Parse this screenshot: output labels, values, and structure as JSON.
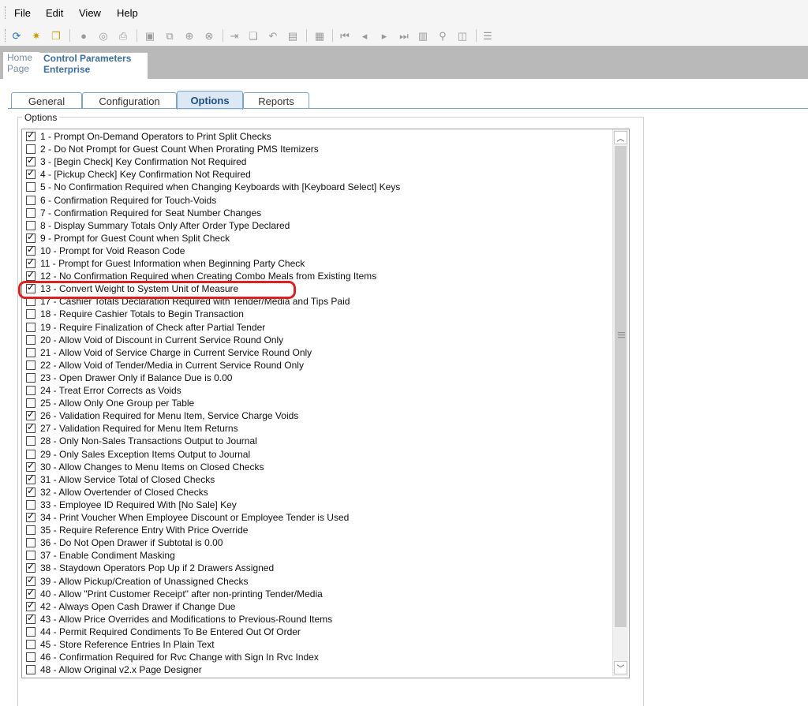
{
  "menubar": {
    "file": "File",
    "edit": "Edit",
    "view": "View",
    "help": "Help"
  },
  "toolbar_icons": [
    "refresh-icon",
    "new-icon",
    "new-copy-icon",
    "record-icon",
    "zoom-icon",
    "print-icon",
    "save-icon",
    "save-all-icon",
    "add-icon",
    "delete-icon",
    "insert-icon",
    "copy-icon",
    "undo-icon",
    "paste-icon",
    "table-icon",
    "first-icon",
    "prev-icon",
    "next-icon",
    "last-icon",
    "goto-icon",
    "find-icon",
    "view-icon",
    "grid-icon"
  ],
  "page_tabs": {
    "home": {
      "line1": "Home",
      "line2": "Page"
    },
    "control": {
      "line1": "Control Parameters",
      "line2": "Enterprise"
    }
  },
  "inner_tabs": [
    {
      "label": "General",
      "active": false
    },
    {
      "label": "Configuration",
      "active": false
    },
    {
      "label": "Options",
      "active": true
    },
    {
      "label": "Reports",
      "active": false
    }
  ],
  "options_group": {
    "legend": "Options",
    "items": [
      {
        "label": "1 - Prompt On-Demand Operators to Print Split Checks",
        "checked": true
      },
      {
        "label": "2 - Do Not Prompt for Guest Count When Prorating PMS Itemizers",
        "checked": false
      },
      {
        "label": "3 - [Begin Check] Key Confirmation Not Required",
        "checked": true
      },
      {
        "label": "4 - [Pickup Check] Key Confirmation Not Required",
        "checked": true
      },
      {
        "label": "5 - No Confirmation Required when Changing Keyboards with [Keyboard Select] Keys",
        "checked": false
      },
      {
        "label": "6 - Confirmation Required for Touch-Voids",
        "checked": false
      },
      {
        "label": "7 - Confirmation Required for Seat Number Changes",
        "checked": false
      },
      {
        "label": "8 - Display Summary Totals Only After Order Type Declared",
        "checked": false
      },
      {
        "label": "9 - Prompt for Guest Count when Split Check",
        "checked": true
      },
      {
        "label": "10 - Prompt for Void Reason Code",
        "checked": true
      },
      {
        "label": "11 - Prompt for Guest Information when Beginning Party Check",
        "checked": true
      },
      {
        "label": "12 - No Confirmation Required when Creating Combo Meals from Existing Items",
        "checked": true
      },
      {
        "label": "13 - Convert Weight to System Unit of Measure",
        "checked": true
      },
      {
        "label": "17 - Cashier Totals Declaration Required with Tender/Media and Tips Paid",
        "checked": false
      },
      {
        "label": "18 - Require Cashier Totals to Begin Transaction",
        "checked": false
      },
      {
        "label": "19 - Require Finalization of Check after Partial Tender",
        "checked": false
      },
      {
        "label": "20 - Allow Void of Discount in Current Service Round Only",
        "checked": false
      },
      {
        "label": "21 - Allow Void of Service Charge in Current Service Round Only",
        "checked": false
      },
      {
        "label": "22 - Allow Void of Tender/Media in Current Service Round Only",
        "checked": false
      },
      {
        "label": "23 - Open Drawer Only if Balance Due is 0.00",
        "checked": false
      },
      {
        "label": "24 - Treat Error Corrects as Voids",
        "checked": false
      },
      {
        "label": "25 - Allow Only One Group per Table",
        "checked": false
      },
      {
        "label": "26 - Validation Required for Menu Item, Service Charge Voids",
        "checked": true
      },
      {
        "label": "27 - Validation Required for Menu Item Returns",
        "checked": true
      },
      {
        "label": "28 - Only Non-Sales Transactions Output to Journal",
        "checked": false
      },
      {
        "label": "29 - Only Sales Exception Items Output to Journal",
        "checked": false
      },
      {
        "label": "30 - Allow Changes to Menu Items on Closed Checks",
        "checked": true
      },
      {
        "label": "31 - Allow Service Total of Closed Checks",
        "checked": true
      },
      {
        "label": "32 - Allow Overtender of Closed Checks",
        "checked": true
      },
      {
        "label": "33 - Employee ID Required With [No Sale] Key",
        "checked": false
      },
      {
        "label": "34 - Print Voucher When Employee Discount or Employee Tender is Used",
        "checked": true
      },
      {
        "label": "35 - Require Reference Entry With Price Override",
        "checked": false
      },
      {
        "label": "36 - Do Not Open Drawer if Subtotal is 0.00",
        "checked": false
      },
      {
        "label": "37 - Enable Condiment Masking",
        "checked": false
      },
      {
        "label": "38 - Staydown Operators Pop Up if 2 Drawers Assigned",
        "checked": true
      },
      {
        "label": "39 - Allow Pickup/Creation of Unassigned Checks",
        "checked": true
      },
      {
        "label": "40 - Allow \"Print Customer Receipt\" after non-printing Tender/Media",
        "checked": true
      },
      {
        "label": "42 - Always Open Cash Drawer if Change Due",
        "checked": true
      },
      {
        "label": "43 - Allow Price Overrides and Modifications to Previous-Round Items",
        "checked": true
      },
      {
        "label": "44 - Permit Required Condiments To Be Entered Out Of Order",
        "checked": false
      },
      {
        "label": "45 - Store Reference Entries In Plain Text",
        "checked": false
      },
      {
        "label": "46 - Confirmation Required for Rvc Change with Sign In Rvc Index",
        "checked": false
      },
      {
        "label": "48 - Allow Original v2.x Page Designer",
        "checked": false
      }
    ]
  },
  "highlight_color": "#e0201f",
  "accent_color": "#1d4f86"
}
